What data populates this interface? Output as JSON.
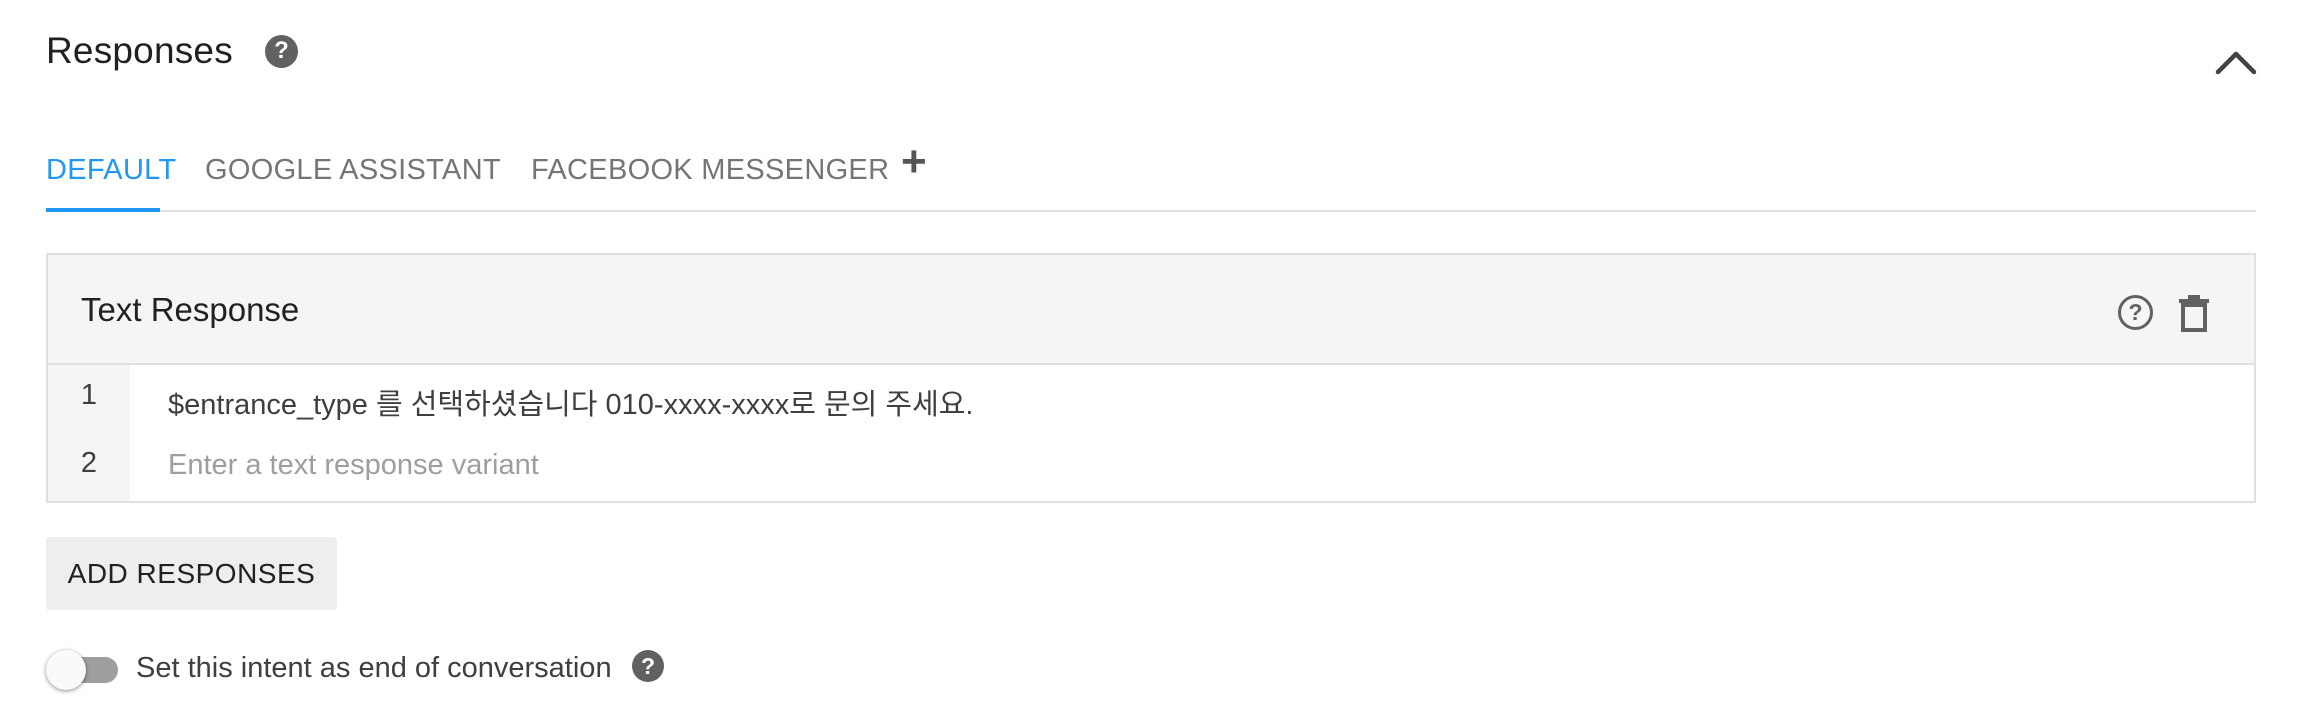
{
  "header": {
    "title": "Responses",
    "help_glyph": "?",
    "help_icon": "help-icon",
    "collapse_icon": "chevron-up-icon"
  },
  "tabs": [
    {
      "label": "DEFAULT",
      "active": true
    },
    {
      "label": "GOOGLE ASSISTANT",
      "active": false
    },
    {
      "label": "FACEBOOK MESSENGER",
      "active": false
    }
  ],
  "add_tab_glyph": "+",
  "card": {
    "title": "Text Response",
    "help_glyph": "?",
    "delete_icon": "trash-icon",
    "rows": [
      {
        "num": "1",
        "value": "$entrance_type 를 선택하셨습니다 010-xxxx-xxxx로 문의 주세요."
      },
      {
        "num": "2",
        "value": "",
        "placeholder": "Enter a text response variant"
      }
    ]
  },
  "add_responses_label": "ADD RESPONSES",
  "end_conversation": {
    "label": "Set this intent as end of conversation",
    "enabled": false,
    "help_glyph": "?"
  },
  "colors": {
    "accent": "#2196f3",
    "icon": "#616161",
    "card_header_bg": "#f5f5f5"
  }
}
